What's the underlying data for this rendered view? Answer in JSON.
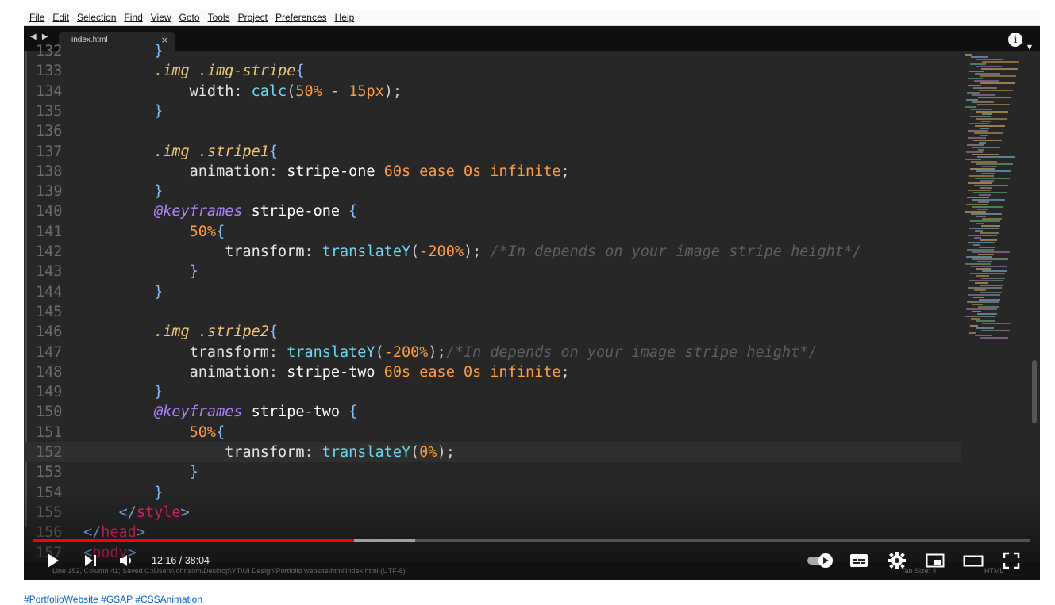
{
  "menubar": {
    "items": [
      "File",
      "Edit",
      "Selection",
      "Find",
      "View",
      "Goto",
      "Tools",
      "Project",
      "Preferences",
      "Help"
    ]
  },
  "tabbar": {
    "nav": "◀ ▶",
    "tab_label": "index.html",
    "tab_close": "×",
    "info": "i",
    "caret": "▼"
  },
  "editor": {
    "lines": [
      {
        "n": "132",
        "tokens": [
          [
            "        ",
            "punc"
          ],
          [
            "}",
            "br"
          ]
        ]
      },
      {
        "n": "133",
        "tokens": [
          [
            "        ",
            "punc"
          ],
          [
            ".img",
            "sel"
          ],
          [
            " ",
            "punc"
          ],
          [
            ".img-stripe",
            "sel"
          ],
          [
            "{",
            "br"
          ]
        ]
      },
      {
        "n": "134",
        "tokens": [
          [
            "            ",
            "punc"
          ],
          [
            "width",
            "prop"
          ],
          [
            ": ",
            "punc"
          ],
          [
            "calc",
            "fn"
          ],
          [
            "(",
            "punc"
          ],
          [
            "50%",
            "num"
          ],
          [
            " - ",
            "punc"
          ],
          [
            "15px",
            "num"
          ],
          [
            ");",
            "punc"
          ]
        ]
      },
      {
        "n": "135",
        "tokens": [
          [
            "        ",
            "punc"
          ],
          [
            "}",
            "br"
          ]
        ]
      },
      {
        "n": "136",
        "tokens": []
      },
      {
        "n": "137",
        "tokens": [
          [
            "        ",
            "punc"
          ],
          [
            ".img",
            "sel"
          ],
          [
            " ",
            "punc"
          ],
          [
            ".stripe1",
            "sel"
          ],
          [
            "{",
            "br"
          ]
        ]
      },
      {
        "n": "138",
        "tokens": [
          [
            "            ",
            "punc"
          ],
          [
            "animation",
            "prop"
          ],
          [
            ": ",
            "punc"
          ],
          [
            "stripe-one",
            "kw"
          ],
          [
            " ",
            "punc"
          ],
          [
            "60s",
            "num"
          ],
          [
            " ",
            "punc"
          ],
          [
            "ease",
            "str"
          ],
          [
            " ",
            "punc"
          ],
          [
            "0s",
            "num"
          ],
          [
            " ",
            "punc"
          ],
          [
            "infinite",
            "str"
          ],
          [
            ";",
            "punc"
          ]
        ]
      },
      {
        "n": "139",
        "tokens": [
          [
            "        ",
            "punc"
          ],
          [
            "}",
            "br"
          ]
        ]
      },
      {
        "n": "140",
        "tokens": [
          [
            "        ",
            "punc"
          ],
          [
            "@keyframes",
            "at"
          ],
          [
            " ",
            "punc"
          ],
          [
            "stripe-one",
            "kw"
          ],
          [
            " {",
            "br"
          ]
        ]
      },
      {
        "n": "141",
        "tokens": [
          [
            "            ",
            "punc"
          ],
          [
            "50%",
            "num"
          ],
          [
            "{",
            "br"
          ]
        ]
      },
      {
        "n": "142",
        "tokens": [
          [
            "                ",
            "punc"
          ],
          [
            "transform",
            "prop"
          ],
          [
            ": ",
            "punc"
          ],
          [
            "translateY",
            "fn"
          ],
          [
            "(",
            "punc"
          ],
          [
            "-200%",
            "num"
          ],
          [
            ");",
            "punc"
          ],
          [
            " ",
            "punc"
          ],
          [
            "/*In depends on your image stripe height*/",
            "cmt"
          ]
        ]
      },
      {
        "n": "143",
        "tokens": [
          [
            "            ",
            "punc"
          ],
          [
            "}",
            "br"
          ]
        ]
      },
      {
        "n": "144",
        "tokens": [
          [
            "        ",
            "punc"
          ],
          [
            "}",
            "br"
          ]
        ]
      },
      {
        "n": "145",
        "tokens": []
      },
      {
        "n": "146",
        "tokens": [
          [
            "        ",
            "punc"
          ],
          [
            ".img",
            "sel"
          ],
          [
            " ",
            "punc"
          ],
          [
            ".stripe2",
            "sel"
          ],
          [
            "{",
            "br"
          ]
        ]
      },
      {
        "n": "147",
        "tokens": [
          [
            "            ",
            "punc"
          ],
          [
            "transform",
            "prop"
          ],
          [
            ": ",
            "punc"
          ],
          [
            "translateY",
            "fn"
          ],
          [
            "(",
            "punc"
          ],
          [
            "-200%",
            "num"
          ],
          [
            ");",
            "punc"
          ],
          [
            "/*In depends on your image stripe height*/",
            "cmt"
          ]
        ]
      },
      {
        "n": "148",
        "tokens": [
          [
            "            ",
            "punc"
          ],
          [
            "animation",
            "prop"
          ],
          [
            ": ",
            "punc"
          ],
          [
            "stripe-two",
            "kw"
          ],
          [
            " ",
            "punc"
          ],
          [
            "60s",
            "num"
          ],
          [
            " ",
            "punc"
          ],
          [
            "ease",
            "str"
          ],
          [
            " ",
            "punc"
          ],
          [
            "0s",
            "num"
          ],
          [
            " ",
            "punc"
          ],
          [
            "infinite",
            "str"
          ],
          [
            ";",
            "punc"
          ]
        ]
      },
      {
        "n": "149",
        "tokens": [
          [
            "        ",
            "punc"
          ],
          [
            "}",
            "br"
          ]
        ]
      },
      {
        "n": "150",
        "tokens": [
          [
            "        ",
            "punc"
          ],
          [
            "@keyframes",
            "at"
          ],
          [
            " ",
            "punc"
          ],
          [
            "stripe-two",
            "kw"
          ],
          [
            " {",
            "br"
          ]
        ]
      },
      {
        "n": "151",
        "tokens": [
          [
            "            ",
            "punc"
          ],
          [
            "50%",
            "num"
          ],
          [
            "{",
            "br"
          ]
        ]
      },
      {
        "n": "152",
        "tokens": [
          [
            "                ",
            "punc"
          ],
          [
            "transform",
            "prop"
          ],
          [
            ": ",
            "punc"
          ],
          [
            "translateY",
            "fn"
          ],
          [
            "(",
            "punc"
          ],
          [
            "0%",
            "num"
          ],
          [
            ");",
            "punc"
          ]
        ],
        "current": true
      },
      {
        "n": "153",
        "tokens": [
          [
            "            ",
            "punc"
          ],
          [
            "}",
            "br"
          ]
        ]
      },
      {
        "n": "154",
        "tokens": [
          [
            "        ",
            "punc"
          ],
          [
            "}",
            "br"
          ]
        ]
      },
      {
        "n": "155",
        "tokens": [
          [
            "    ",
            "punc"
          ],
          [
            "</",
            "br"
          ],
          [
            "style",
            "tag"
          ],
          [
            ">",
            "br"
          ]
        ]
      },
      {
        "n": "156",
        "tokens": [
          [
            "</",
            "br"
          ],
          [
            "head",
            "tag"
          ],
          [
            ">",
            "br"
          ]
        ]
      },
      {
        "n": "157",
        "tokens": [
          [
            "<",
            "br"
          ],
          [
            "body",
            "tag"
          ],
          [
            ">",
            "br"
          ]
        ]
      }
    ]
  },
  "statusbar": {
    "text": "Line 152, Column 41; Saved C:\\Users\\johnsom\\Desktop\\YT\\UI Design\\Portfolio website\\html\\index.html (UTF-8)",
    "tab_size": "Tab Size: 4",
    "syntax": "HTML"
  },
  "player": {
    "time": "12:16 / 38:04",
    "played_fraction": 0.322,
    "buffered_fraction": 0.383,
    "icons": [
      "play-icon",
      "next-icon",
      "volume-icon",
      "autoplay-toggle-icon",
      "subtitles-icon",
      "settings-icon",
      "miniplayer-icon",
      "theater-mode-icon",
      "fullscreen-icon"
    ]
  },
  "hashtags": "#PortfolioWebsite #GSAP #CSSAnimation",
  "colors": {
    "progress_played": "#ff0000",
    "editor_bg": "#272727",
    "selector": "#f0c674",
    "function": "#66d9ef",
    "number": "#ff9d3b",
    "at_rule": "#ae81ff",
    "tag": "#f92672",
    "link": "#065fd4"
  }
}
